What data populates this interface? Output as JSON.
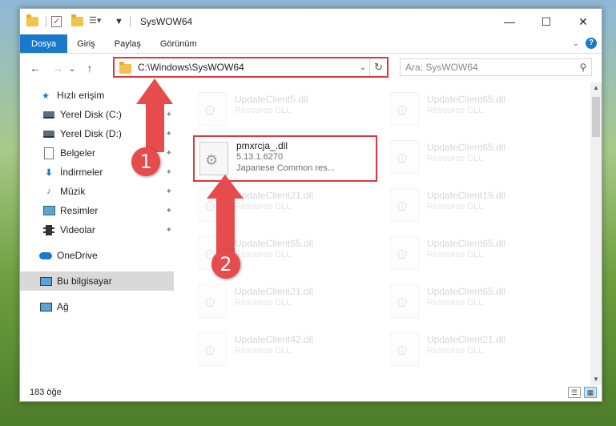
{
  "window": {
    "title": "SysWOW64",
    "controls": {
      "minimize": "—",
      "maximize": "☐",
      "close": "✕"
    }
  },
  "ribbon": {
    "tabs": [
      {
        "label": "Dosya",
        "active": true
      },
      {
        "label": "Giriş"
      },
      {
        "label": "Paylaş"
      },
      {
        "label": "Görünüm"
      }
    ],
    "help": "?"
  },
  "navbar": {
    "back": "←",
    "forward": "→",
    "recent": "⌄",
    "up": "↑",
    "address": "C:\\Windows\\SysWOW64",
    "address_dropdown": "⌄",
    "refresh": "↻",
    "search_placeholder": "Ara: SysWOW64",
    "search_icon": "search-icon"
  },
  "sidebar": {
    "items": [
      {
        "label": "Hızlı erişim",
        "icon": "star-icon"
      },
      {
        "label": "Yerel Disk (C:)",
        "icon": "disk-icon",
        "pinned": true
      },
      {
        "label": "Yerel Disk (D:)",
        "icon": "disk-icon",
        "pinned": true
      },
      {
        "label": "Belgeler",
        "icon": "document-icon",
        "pinned": true
      },
      {
        "label": "İndirmeler",
        "icon": "download-icon",
        "pinned": true
      },
      {
        "label": "Müzik",
        "icon": "music-icon",
        "pinned": true
      },
      {
        "label": "Resimler",
        "icon": "pictures-icon",
        "pinned": true
      },
      {
        "label": "Videolar",
        "icon": "videos-icon",
        "pinned": true
      },
      {
        "label": "OneDrive",
        "icon": "cloud-icon"
      },
      {
        "label": "Bu bilgisayar",
        "icon": "computer-icon",
        "selected": true
      },
      {
        "label": "Ağ",
        "icon": "network-icon"
      }
    ]
  },
  "files": {
    "left": [
      {
        "name": "UpdateClient5.dll",
        "sub": "Resource DLL"
      },
      {
        "name": "pmxrcja_.dll",
        "version": "5.13.1.6270",
        "desc": "Japanese Common res..."
      },
      {
        "name": "UpdateClient21.dll",
        "sub": "Resource DLL"
      },
      {
        "name": "UpdateClient65.dll",
        "sub": "Resource DLL"
      },
      {
        "name": "UpdateClient21.dll",
        "sub": "Resource DLL"
      },
      {
        "name": "UpdateClient42.dll",
        "sub": "Resource DLL"
      }
    ],
    "right": [
      {
        "name": "UpdateClient65.dll",
        "sub": "Resource DLL"
      },
      {
        "name": "UpdateClient65.dll",
        "sub": "Resource DLL"
      },
      {
        "name": "UpdateClient19.dll",
        "sub": "Resource DLL"
      },
      {
        "name": "UpdateClient65.dll",
        "sub": "Resource DLL"
      },
      {
        "name": "UpdateClient65.dll",
        "sub": "Resource DLL"
      },
      {
        "name": "UpdateClient21.dll",
        "sub": "Resource DLL"
      }
    ]
  },
  "status": {
    "count": "183 öğe"
  },
  "annotations": {
    "marker1": "1",
    "marker2": "2",
    "color": "#e74c4c"
  }
}
